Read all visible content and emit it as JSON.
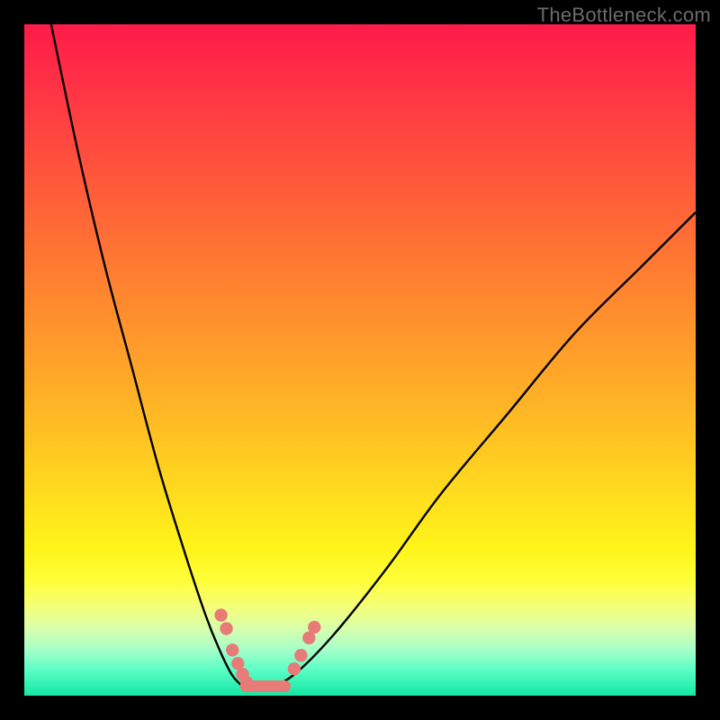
{
  "watermark": "TheBottleneck.com",
  "colors": {
    "background": "#000000",
    "curve": "#000000",
    "marker": "#e77b78"
  },
  "chart_data": {
    "type": "line",
    "title": "",
    "xlabel": "",
    "ylabel": "",
    "xlim": [
      0,
      100
    ],
    "ylim": [
      0,
      100
    ],
    "grid": false,
    "legend": false,
    "series": [
      {
        "name": "left-curve",
        "x": [
          4,
          8,
          12,
          16,
          20,
          24,
          27,
          29,
          31,
          33
        ],
        "y": [
          100,
          81,
          64,
          49,
          34,
          21,
          12,
          7,
          3,
          1
        ]
      },
      {
        "name": "right-curve",
        "x": [
          36,
          40,
          46,
          54,
          62,
          72,
          82,
          92,
          100
        ],
        "y": [
          1,
          3,
          9,
          19,
          30,
          42,
          54,
          64,
          72
        ]
      }
    ],
    "markers": {
      "left_cluster": [
        {
          "x": 29.3,
          "y": 12.0
        },
        {
          "x": 30.1,
          "y": 10.0
        },
        {
          "x": 31.0,
          "y": 6.8
        },
        {
          "x": 31.8,
          "y": 4.8
        },
        {
          "x": 32.5,
          "y": 3.2
        },
        {
          "x": 33.1,
          "y": 2.0
        }
      ],
      "right_cluster": [
        {
          "x": 40.2,
          "y": 4.0
        },
        {
          "x": 41.2,
          "y": 6.0
        },
        {
          "x": 42.4,
          "y": 8.6
        },
        {
          "x": 43.2,
          "y": 10.2
        }
      ],
      "platform": {
        "x_start": 33.0,
        "y": 1.4,
        "x_end": 38.8
      }
    },
    "background_gradient_stops": [
      {
        "pos": 0,
        "color": "#ff1b49"
      },
      {
        "pos": 50,
        "color": "#ffb524"
      },
      {
        "pos": 80,
        "color": "#fff41a"
      },
      {
        "pos": 100,
        "color": "#13e6a3"
      }
    ]
  }
}
